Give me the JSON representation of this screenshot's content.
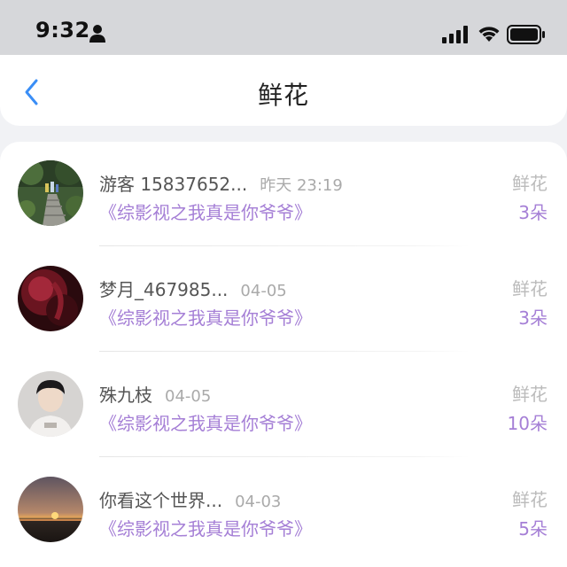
{
  "status_bar": {
    "time": "9:32",
    "icons": [
      "person-icon",
      "signal-icon",
      "wifi-icon",
      "battery-icon"
    ]
  },
  "header": {
    "title": "鲜花",
    "back_icon": "chevron-left-icon"
  },
  "colors": {
    "accent": "#a57fd6",
    "back": "#3a8ef6",
    "muted": "#aaaaaa"
  },
  "items": [
    {
      "name": "游客 15837652...",
      "time": "昨天 23:19",
      "book": "《综影视之我真是你爷爷》",
      "gift_label": "鲜花",
      "gift_count": "3朵",
      "avatar": "avatar-forest-path"
    },
    {
      "name": "梦月_467985...",
      "time": "04-05",
      "book": "《综影视之我真是你爷爷》",
      "gift_label": "鲜花",
      "gift_count": "3朵",
      "avatar": "avatar-dark-red"
    },
    {
      "name": "殊九枝",
      "time": "04-05",
      "book": "《综影视之我真是你爷爷》",
      "gift_label": "鲜花",
      "gift_count": "10朵",
      "avatar": "avatar-portrait"
    },
    {
      "name": "你看这个世界...",
      "time": "04-03",
      "book": "《综影视之我真是你爷爷》",
      "gift_label": "鲜花",
      "gift_count": "5朵",
      "avatar": "avatar-sunset"
    }
  ]
}
